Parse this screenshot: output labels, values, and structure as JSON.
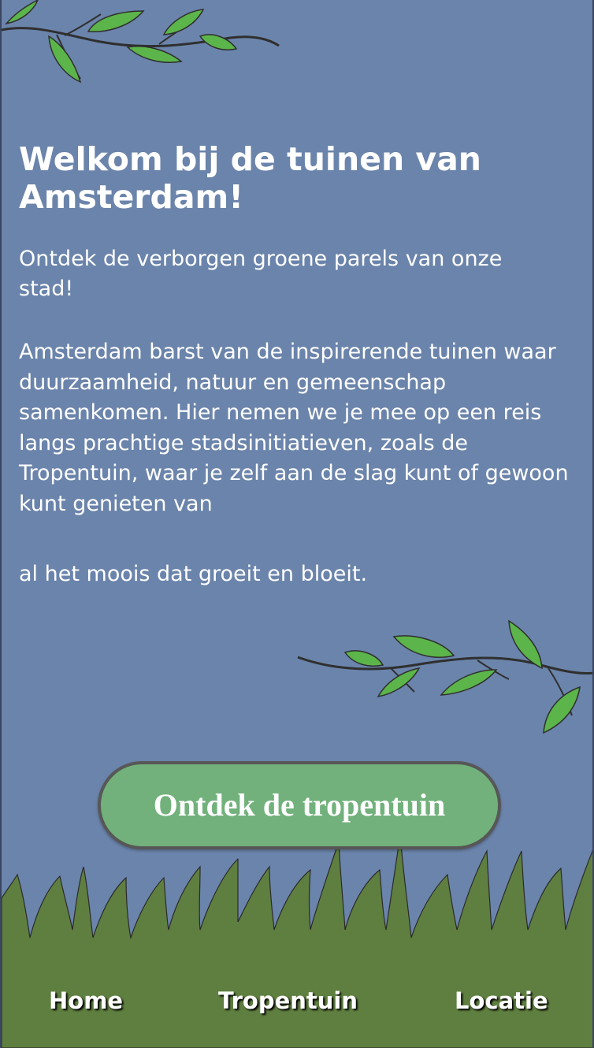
{
  "hero": {
    "title": "Welkom bij de tuinen van Amsterdam!",
    "subtitle": "Ontdek de verborgen groene parels van onze stad!",
    "intro": "Amsterdam barst van de inspirerende tuinen waar duurzaamheid, natuur en gemeenschap samenkomen. Hier nemen we je mee op een reis langs prachtige stadsinitiatieven, zoals de Tropentuin, waar je zelf aan de slag kunt of gewoon kunt genieten van",
    "outro": "al het moois dat groeit en bloeit."
  },
  "cta": {
    "label": "Ontdek de tropentuin"
  },
  "nav": {
    "items": [
      {
        "label": "Home"
      },
      {
        "label": "Tropentuin"
      },
      {
        "label": "Locatie"
      }
    ]
  },
  "colors": {
    "background": "#6b84ab",
    "button": "#72b17c",
    "button_border": "#575757",
    "grass": "#5f7f40",
    "leaf": "#5cb54a",
    "text": "#ffffff"
  },
  "icons": {
    "top_decoration": "branch-with-leaves-icon",
    "middle_decoration": "branch-with-leaves-icon",
    "ground_decoration": "grass-icon"
  }
}
